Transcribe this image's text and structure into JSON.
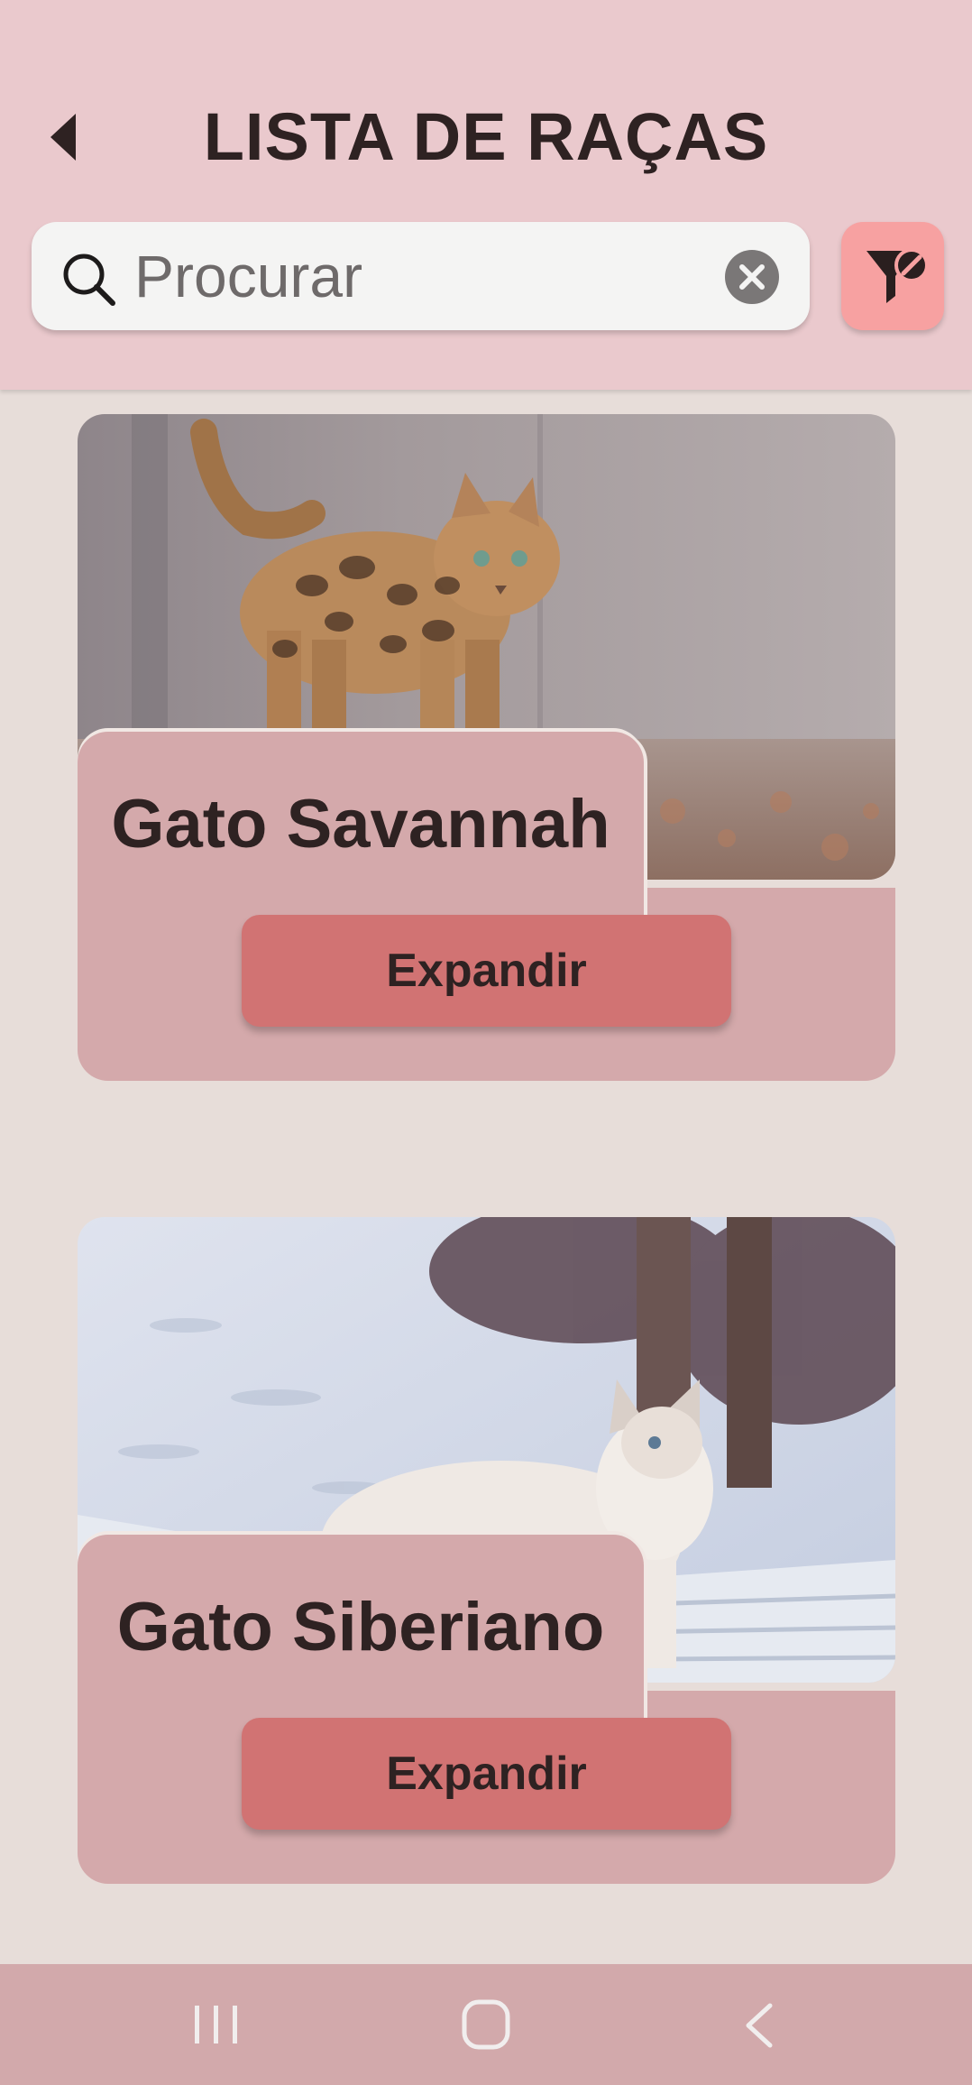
{
  "header": {
    "title": "LISTA DE RAÇAS",
    "back_icon": "chevron-left-icon"
  },
  "search": {
    "placeholder": "Procurar",
    "value": "",
    "search_icon": "search-icon",
    "clear_icon": "clear-icon"
  },
  "filter": {
    "icon": "filter-off-icon",
    "color": "#f7a1a1"
  },
  "breeds": [
    {
      "name": "Gato Savannah",
      "button_label": "Expandir",
      "image": "spotted-cat-photo"
    },
    {
      "name": "Gato Siberiano",
      "button_label": "Expandir",
      "image": "white-cat-in-snow-photo"
    }
  ],
  "colors": {
    "header_bg": "#eac9cd",
    "page_bg": "#e7ddd9",
    "card_bg": "#d4a9ab",
    "button_bg": "#d17373",
    "navbar_bg": "#d2a9ab"
  },
  "system_nav": {
    "recents_icon": "recents-icon",
    "home_icon": "home-icon",
    "back_icon": "back-icon"
  }
}
